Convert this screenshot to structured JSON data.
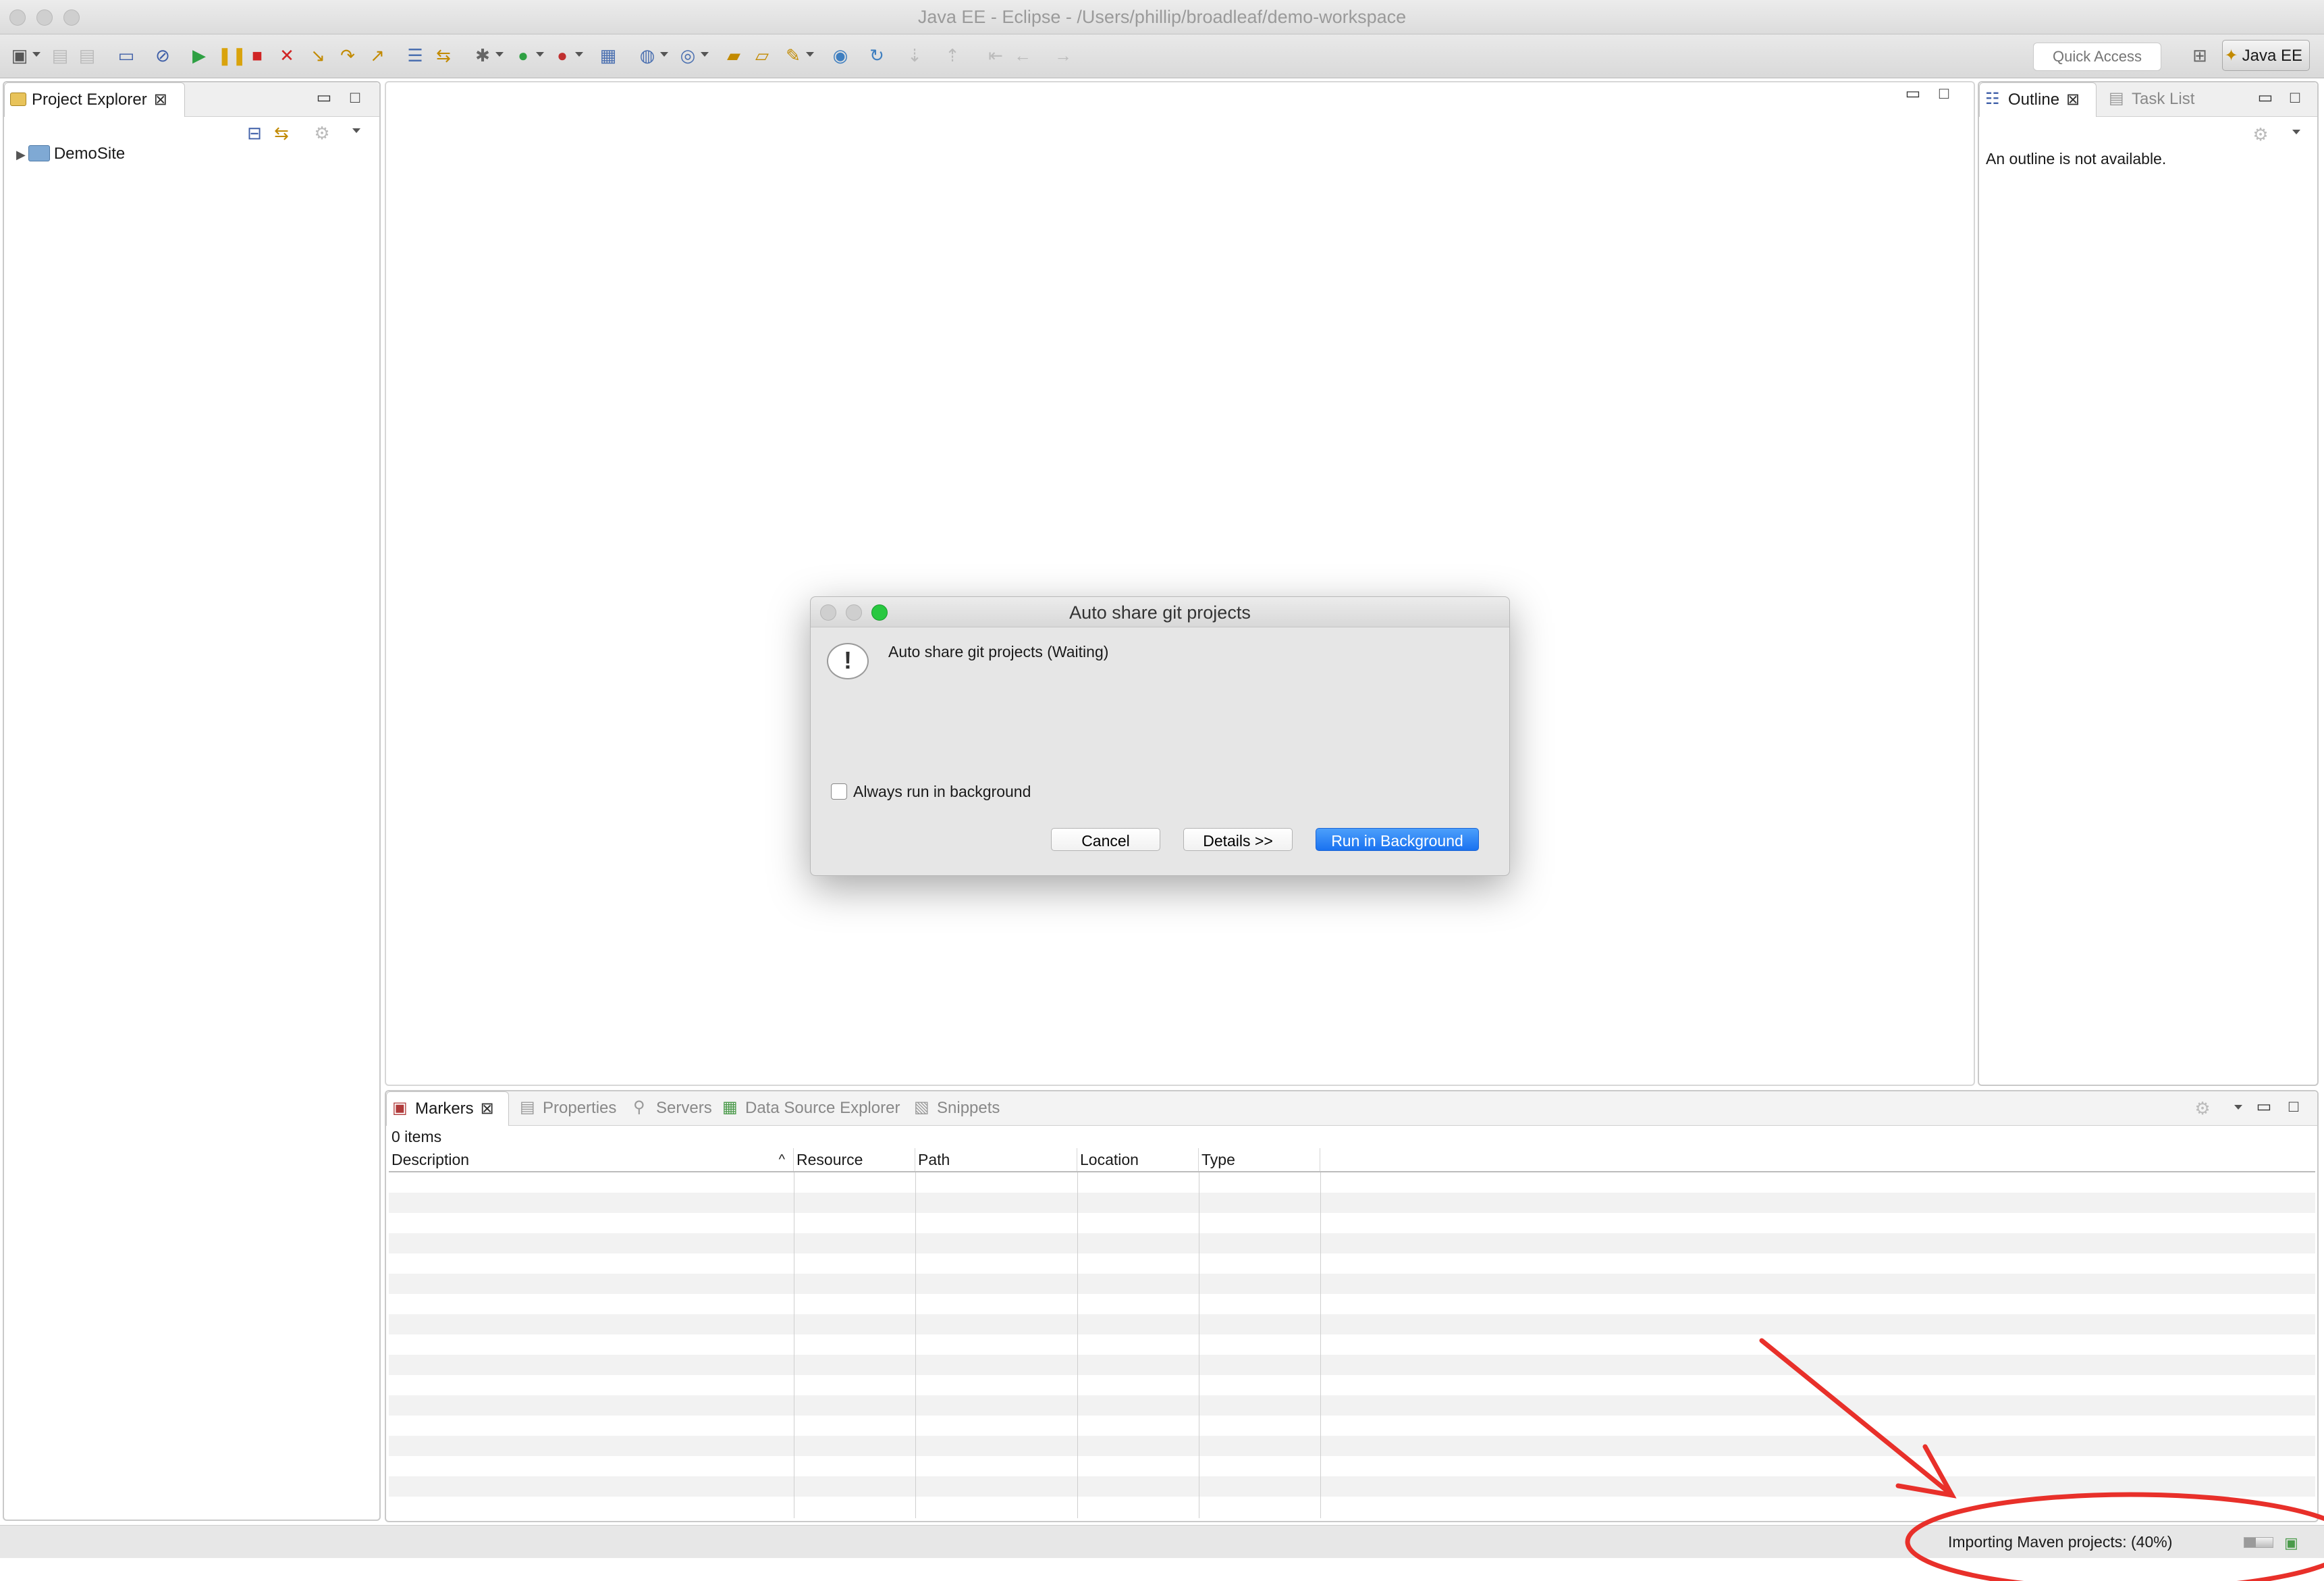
{
  "window": {
    "title": "Java EE - Eclipse - /Users/phillip/broadleaf/demo-workspace"
  },
  "toolbar": {
    "quick_access_placeholder": "Quick Access",
    "perspective_label": "Java EE"
  },
  "project_explorer": {
    "tab_label": "Project Explorer",
    "tree": [
      {
        "label": "DemoSite",
        "expanded": false
      }
    ]
  },
  "outline": {
    "tabs": [
      {
        "label": "Outline",
        "active": true
      },
      {
        "label": "Task List",
        "active": false
      }
    ],
    "message": "An outline is not available."
  },
  "dialog": {
    "title": "Auto share git projects",
    "message": "Auto share git projects (Waiting)",
    "checkbox_label": "Always run in background",
    "checkbox_checked": false,
    "buttons": {
      "cancel": "Cancel",
      "details": "Details >>",
      "run_background": "Run in Background"
    }
  },
  "bottom_panel": {
    "tabs": [
      {
        "label": "Markers",
        "active": true
      },
      {
        "label": "Properties",
        "active": false
      },
      {
        "label": "Servers",
        "active": false
      },
      {
        "label": "Data Source Explorer",
        "active": false
      },
      {
        "label": "Snippets",
        "active": false
      }
    ],
    "items_count": "0 items",
    "columns": [
      "Description",
      "Resource",
      "Path",
      "Location",
      "Type"
    ]
  },
  "status_bar": {
    "text": "Importing Maven projects: (40%)",
    "progress_percent": 40
  },
  "colors": {
    "accent": "#1a72f0",
    "annotation": "#e8302a",
    "close_red": "#ff5f57",
    "zoom_green": "#28c840"
  }
}
